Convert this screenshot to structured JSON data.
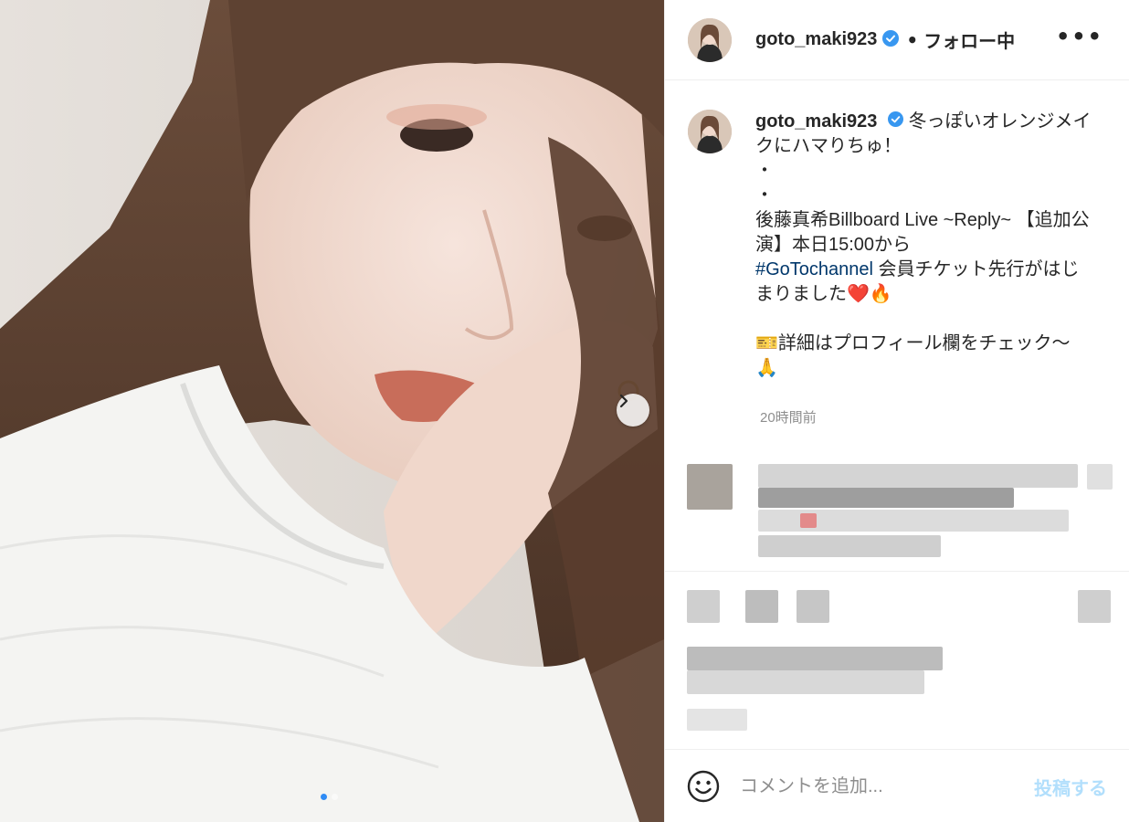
{
  "post": {
    "username": "goto_maki923",
    "separator": "•",
    "follow_status": "フォロー中",
    "more_label": "•••",
    "caption_lines": [
      "冬っぽいオレンジメイ",
      "クにハマりちゅ！",
      "・",
      "・",
      "後藤真希Billboard Live ~Reply~ 【追加公",
      "演】本日15:00から"
    ],
    "hashtag": "#GoTochannel",
    "caption_after_hashtag": " 会員チケット先行がはじ",
    "caption_line_emoji": "まりました❤️🔥",
    "caption_detail": "🎫詳細はプロフィール欄をチェック〜",
    "caption_end_emoji": "🙏",
    "timestamp": "20時間前"
  },
  "comment_box": {
    "placeholder": "コメントを追加...",
    "post_label": "投稿する"
  },
  "colors": {
    "verified": "#3897f0",
    "hashtag": "#00376b",
    "post_button_disabled": "#b2dffc",
    "carousel_active_dot": "#2f8bf5"
  },
  "icons": [
    "verified-badge-icon",
    "chevron-right-icon",
    "more-options-icon",
    "emoji-icon"
  ],
  "carousel": {
    "total": 2,
    "active": 1
  }
}
